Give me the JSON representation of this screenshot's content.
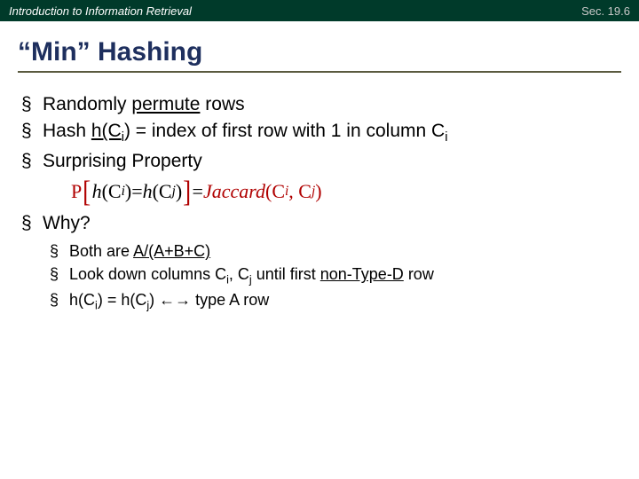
{
  "header": {
    "left": "Introduction to Information Retrieval",
    "right": "Sec. 19.6"
  },
  "title": "“Min” Hashing",
  "bullets": {
    "b1_pre": "Randomly ",
    "b1_em": "permute",
    "b1_post": " rows",
    "b2_pre": "Hash ",
    "b2_fn": "h(C",
    "b2_sub": "i",
    "b2_mid": ") = index of first row with 1 in column C",
    "b2_sub2": "i",
    "b3": "Surprising Property",
    "b4": "Why?"
  },
  "equation": {
    "p": "P",
    "lb": "[",
    "h1": "h",
    "c1a": "(C",
    "c1s": "i",
    "c1b": ")",
    "eq1": " = ",
    "h2": "h",
    "c2a": "(C",
    "c2s": "j",
    "c2b": ")",
    "rb": "]",
    "eq2": " = ",
    "jac": "Jaccard",
    "ja": "(C",
    "js1": "i",
    "jm": ", C",
    "js2": "j",
    "jb": ")"
  },
  "sub": {
    "s1_pre": "Both are ",
    "s1_em": "A/(A+B+C)",
    "s2_pre": "Look down columns C",
    "s2_s1": "i",
    "s2_mid": ", C",
    "s2_s2": "j",
    "s2_post": " until first ",
    "s2_u": "non-Type-D",
    "s2_end": " row",
    "s3_a": "h(C",
    "s3_s1": "i",
    "s3_b": ") = h(C",
    "s3_s2": "j",
    "s3_c": ") ←→ type A row"
  }
}
